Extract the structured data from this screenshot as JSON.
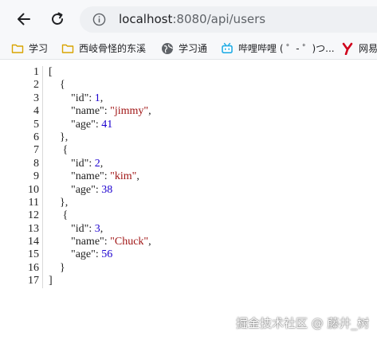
{
  "addressbar": {
    "host": "localhost",
    "path": ":8080/api/users",
    "info_icon": "info-icon"
  },
  "nav": {
    "back_icon": "arrow-left-icon",
    "reload_icon": "reload-icon"
  },
  "bookmarks": [
    {
      "label": "学习",
      "icon": "folder-icon"
    },
    {
      "label": "西岐骨怪的东溪",
      "icon": "folder-icon"
    },
    {
      "label": "学习通",
      "icon": "globe-icon"
    },
    {
      "label": "哔哩哔哩 ( ゜- ゜)つ...",
      "icon": "bilibili-icon"
    },
    {
      "label": "网易",
      "icon": "y-logo-icon"
    }
  ],
  "json_view": {
    "line_numbers": [
      "1",
      "2",
      "3",
      "4",
      "5",
      "6",
      "7",
      "8",
      "9",
      "10",
      "11",
      "12",
      "13",
      "14",
      "15",
      "16",
      "17"
    ],
    "users": [
      {
        "id": "1",
        "name": "\"jimmy\"",
        "age": "41"
      },
      {
        "id": "2",
        "name": "\"kim\"",
        "age": "38"
      },
      {
        "id": "3",
        "name": "\"Chuck\"",
        "age": "56"
      }
    ],
    "keys": {
      "id": "\"id\"",
      "name": "\"name\"",
      "age": "\"age\""
    }
  },
  "watermark": "掘金技术社区 @ 藤井_树",
  "colors": {
    "string": "#a01515",
    "number": "#1c00cf",
    "folder": "#f4c542",
    "bilibili": "#23ade5",
    "y_logo": "#d0021b"
  }
}
